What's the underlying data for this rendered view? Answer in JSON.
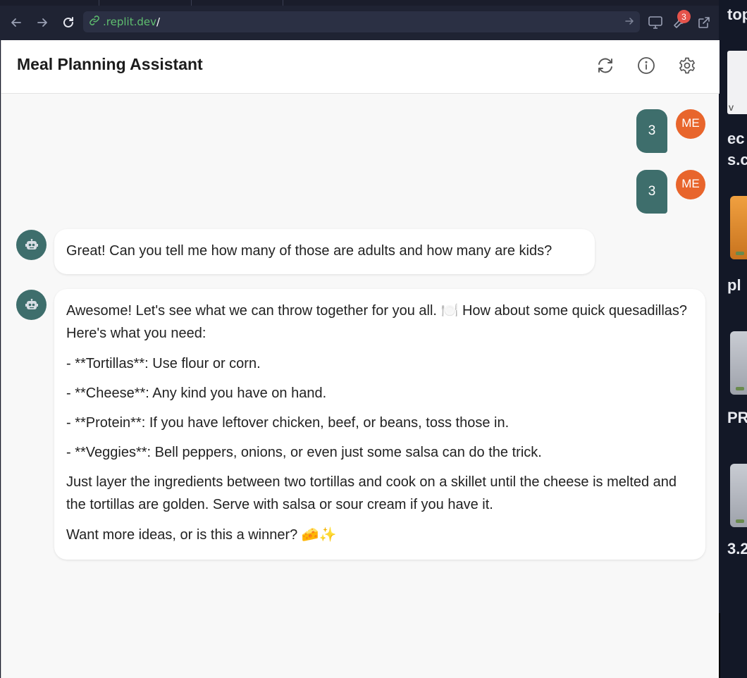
{
  "browser": {
    "url_domain": ".replit.dev",
    "url_path": "/",
    "notification_count": "3"
  },
  "desktop": {
    "labels": [
      "top",
      "v",
      "ec",
      "s.c",
      "pl",
      "PR",
      "3.2"
    ]
  },
  "app": {
    "title": "Meal Planning Assistant"
  },
  "chat": {
    "user_avatar_label": "ME",
    "messages": [
      {
        "role": "user",
        "text": "3"
      },
      {
        "role": "user",
        "text": "3"
      },
      {
        "role": "assistant",
        "text": "Great! Can you tell me how many of those are adults and how many are kids?"
      },
      {
        "role": "assistant",
        "paragraphs": [
          "Awesome! Let's see what we can throw together for you all. 🍽️ How about some quick quesadillas? Here's what you need:",
          "- **Tortillas**: Use flour or corn.",
          "- **Cheese**: Any kind you have on hand.",
          "- **Protein**: If you have leftover chicken, beef, or beans, toss those in.",
          "- **Veggies**: Bell peppers, onions, or even just some salsa can do the trick.",
          "Just layer the ingredients between two tortillas and cook on a skillet until the cheese is melted and the tortillas are golden. Serve with salsa or sour cream if you have it.",
          "Want more ideas, or is this a winner? 🧀✨"
        ]
      }
    ]
  },
  "colors": {
    "user_bubble": "#3e6e6c",
    "user_avatar": "#e8652c",
    "bot_avatar": "#3e6e6c",
    "url_domain": "#5fbf6f",
    "badge": "#e5534b"
  }
}
